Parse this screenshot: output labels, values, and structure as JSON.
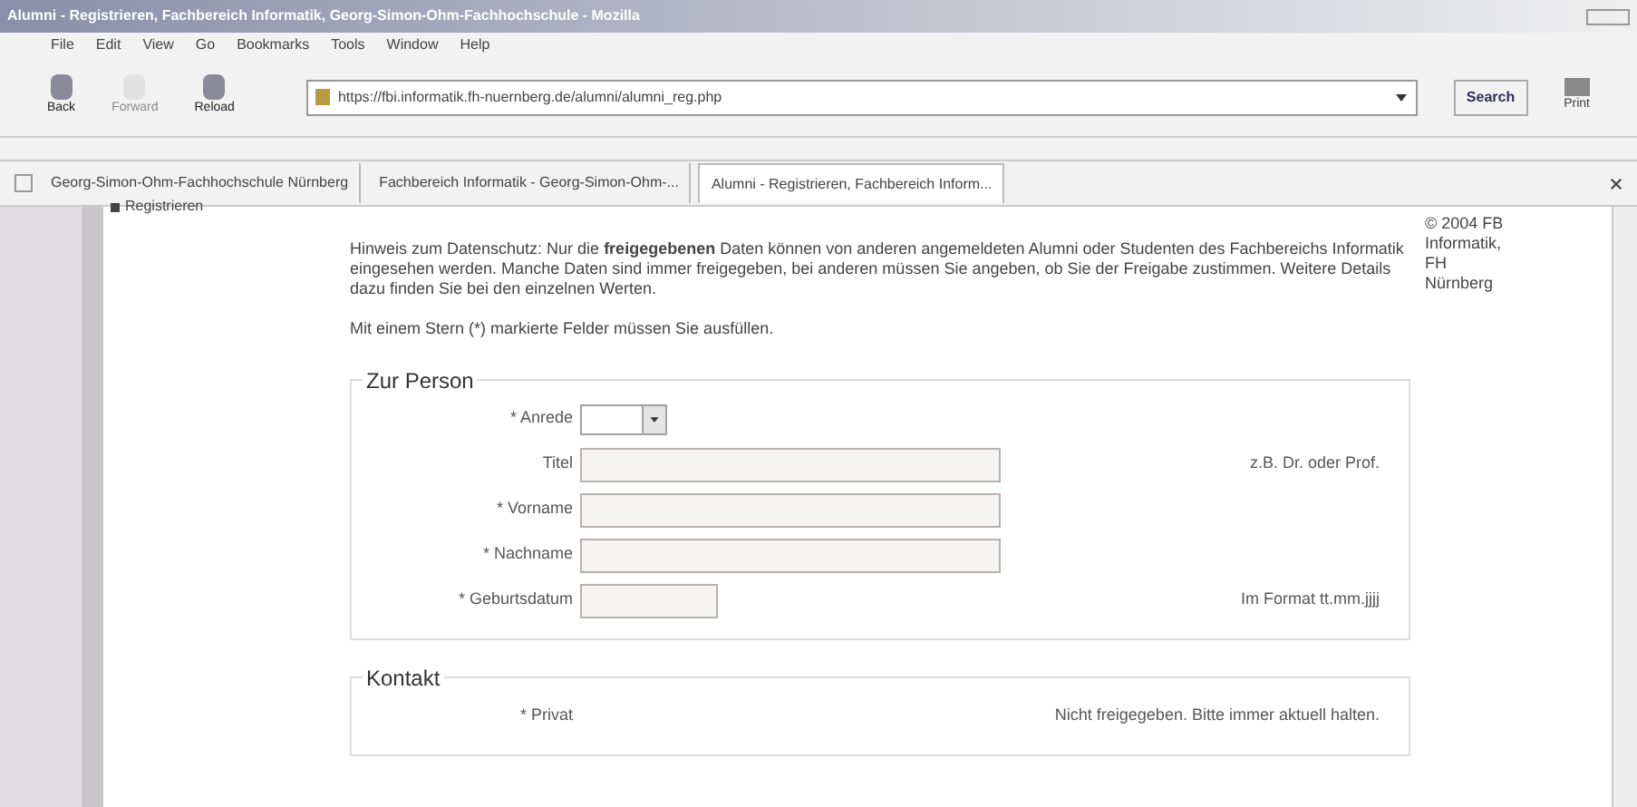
{
  "window": {
    "title": "Alumni - Registrieren, Fachbereich Informatik, Georg-Simon-Ohm-Fachhochschule - Mozilla"
  },
  "menu": [
    "File",
    "Edit",
    "View",
    "Go",
    "Bookmarks",
    "Tools",
    "Window",
    "Help"
  ],
  "toolbar": [
    {
      "label": "Back",
      "disabled": false
    },
    {
      "label": "Forward",
      "disabled": true
    },
    {
      "label": "Reload",
      "disabled": false
    }
  ],
  "address": {
    "value": "https://fbi.informatik.fh-nuernberg.de/alumni/alumni_reg.php"
  },
  "search_button": "Search",
  "print_button": "Print",
  "tabs": [
    {
      "label": "Georg-Simon-Ohm-Fachhochschule Nürnberg",
      "selected": false
    },
    {
      "label": "Fachbereich Informatik - Georg-Simon-Ohm-...",
      "selected": false
    },
    {
      "label": "Alumni - Registrieren, Fachbereich Inform...",
      "selected": true
    }
  ],
  "sidebar": {
    "items": [
      "Registrieren"
    ]
  },
  "notice": "Hinweis zum Datenschutz: Nur die **freigegebenen** Daten können von anderen angemeldeten Alumni oder Studenten des Fachbereichs Informatik eingesehen werden. Manche Daten sind immer freigegeben, bei anderen müssen Sie angeben, ob Sie der Freigabe zustimmen. Weitere Details dazu finden Sie bei den einzelnen Werten.",
  "required_note": "Mit einem Stern (*) markierte Felder müssen Sie ausfüllen.",
  "copyright": "© 2004 FB Informatik, FH Nürnberg",
  "sections": [
    {
      "title": "Zur Person",
      "fields": [
        {
          "label": "* Anrede",
          "kind": "select"
        },
        {
          "label": "Titel",
          "kind": "text",
          "hint": "z.B. Dr. oder Prof."
        },
        {
          "label": "* Vorname",
          "kind": "text"
        },
        {
          "label": "* Nachname",
          "kind": "text"
        },
        {
          "label": "* Geburtsdatum",
          "kind": "date",
          "hint": "Im Format tt.mm.jjjj"
        }
      ]
    },
    {
      "title": "Kontakt",
      "fields": [
        {
          "label": "* Privat",
          "kind": "none",
          "hint": "Nicht freigegeben. Bitte immer aktuell halten."
        }
      ]
    }
  ]
}
